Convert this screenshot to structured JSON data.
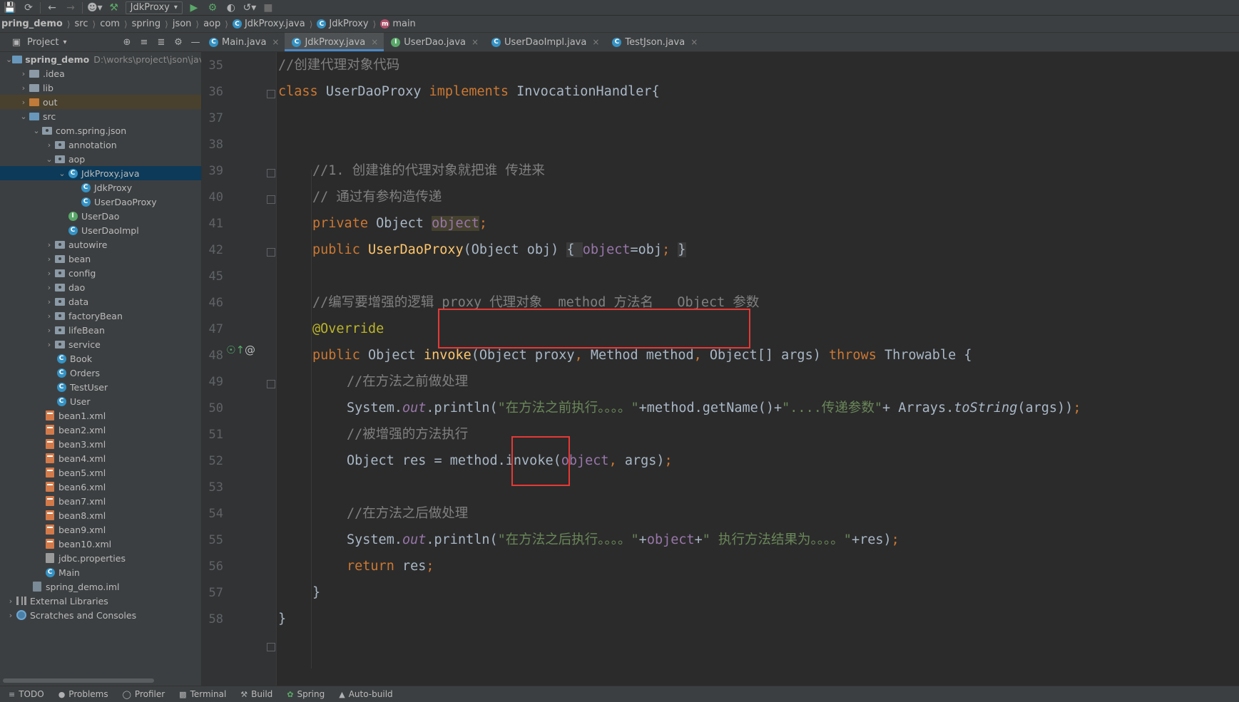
{
  "toolbar": {
    "run_config": "JdkProxy"
  },
  "breadcrumbs": [
    "pring_demo",
    "src",
    "com",
    "spring",
    "json",
    "aop",
    "JdkProxy.java",
    "JdkProxy",
    "main"
  ],
  "project_panel": {
    "title": "Project"
  },
  "tabs": [
    {
      "label": "Main.java",
      "active": false
    },
    {
      "label": "JdkProxy.java",
      "active": true
    },
    {
      "label": "UserDao.java",
      "active": false
    },
    {
      "label": "UserDaoImpl.java",
      "active": false
    },
    {
      "label": "TestJson.java",
      "active": false
    }
  ],
  "tree": {
    "root_name": "spring_demo",
    "root_path": "D:\\works\\project\\json\\java",
    "n_idea": ".idea",
    "n_lib": "lib",
    "n_out": "out",
    "n_src": "src",
    "n_pkg": "com.spring.json",
    "n_annotation": "annotation",
    "n_aop": "aop",
    "n_jdkproxy_java": "JdkProxy.java",
    "n_jdkproxy": "JdkProxy",
    "n_userdaoproxy": "UserDaoProxy",
    "n_userdao": "UserDao",
    "n_userdaoimpl": "UserDaoImpl",
    "n_autowire": "autowire",
    "n_bean": "bean",
    "n_config": "config",
    "n_dao": "dao",
    "n_data": "data",
    "n_factorybean": "factoryBean",
    "n_lifebean": "lifeBean",
    "n_service": "service",
    "n_book": "Book",
    "n_orders": "Orders",
    "n_testuser": "TestUser",
    "n_user": "User",
    "n_bean1": "bean1.xml",
    "n_bean2": "bean2.xml",
    "n_bean3": "bean3.xml",
    "n_bean4": "bean4.xml",
    "n_bean5": "bean5.xml",
    "n_bean6": "bean6.xml",
    "n_bean7": "bean7.xml",
    "n_bean8": "bean8.xml",
    "n_bean9": "bean9.xml",
    "n_bean10": "bean10.xml",
    "n_jdbc": "jdbc.properties",
    "n_main": "Main",
    "n_iml": "spring_demo.iml",
    "n_extlib": "External Libraries",
    "n_scratch": "Scratches and Consoles"
  },
  "line_numbers": [
    "35",
    "36",
    "37",
    "38",
    "39",
    "40",
    "41",
    "42",
    "45",
    "46",
    "47",
    "48",
    "49",
    "50",
    "51",
    "52",
    "53",
    "54",
    "55",
    "56",
    "57",
    "58"
  ],
  "code": {
    "l35": "//创建代理对象代码",
    "l36_kw1": "class",
    "l36_name": " UserDaoProxy ",
    "l36_kw2": "implements",
    "l36_rest": " InvocationHandler{",
    "l39": "//1. 创建谁的代理对象就把谁 传进来",
    "l40": "// 通过有参构造传递",
    "l41_kw": "private",
    "l41_type": " Object ",
    "l41_field": "object",
    "l41_end": ";",
    "l42_kw": "public",
    "l42_name": "UserDaoProxy",
    "l42_params": "(Object obj) ",
    "l42_ob": "{ ",
    "l42_field": "object",
    "l42_assign": "=obj",
    "l42_semi": ";",
    "l42_sp": " ",
    "l42_cb": "}",
    "l46_a": "//编写要增强的逻辑",
    "l46_b": " proxy 代理对象  method 方法名   Object 参数",
    "l47": "@Override",
    "l48_kw": "public",
    "l48_type": " Object ",
    "l48_name": "invoke",
    "l48_p1": "(Object proxy",
    "l48_c1": ",",
    "l48_p2": " Method method",
    "l48_c2": ",",
    "l48_p3": " Object[] args) ",
    "l48_throws": "throws",
    "l48_end": " Throwable {",
    "l49": "//在方法之前做处理",
    "l50_sys": "System.",
    "l50_out": "out",
    "l50_pl": ".println(",
    "l50_s1": "\"在方法之前执行。。。。\"",
    "l50_mid": "+method.getName()+",
    "l50_s2": "\"....传递参数\"",
    "l50_arr": "+ Arrays.",
    "l50_ts": "toString",
    "l50_end": "(args))",
    "l50_semi": ";",
    "l51": "//被增强的方法执行",
    "l52_a": "Object res = method.",
    "l52_b": "invoke(",
    "l52_field": "object",
    "l52_c": ",",
    "l52_d": " args)",
    "l52_semi": ";",
    "l54": "//在方法之后做处理",
    "l55_sys": "System.",
    "l55_out": "out",
    "l55_pl": ".println(",
    "l55_s1": "\"在方法之后执行。。。。\"",
    "l55_plus1": "+",
    "l55_field": "object",
    "l55_plus2": "+",
    "l55_s2": "\" 执行方法结果为。。。。\"",
    "l55_end": "+res)",
    "l55_semi": ";",
    "l56_kw": "return",
    "l56_rest": " res",
    "l56_semi": ";",
    "l57": "}",
    "l58": "}"
  },
  "statusbar": [
    "TODO",
    "Problems",
    "Profiler",
    "Terminal",
    "Build",
    "Spring",
    "Auto-build"
  ],
  "colors": {
    "keyword": "#cc7832",
    "comment": "#808080",
    "method": "#ffc66d",
    "field": "#9876aa",
    "string": "#6a8759",
    "annotation": "#bbb529",
    "highlight_box": "#e53935"
  }
}
